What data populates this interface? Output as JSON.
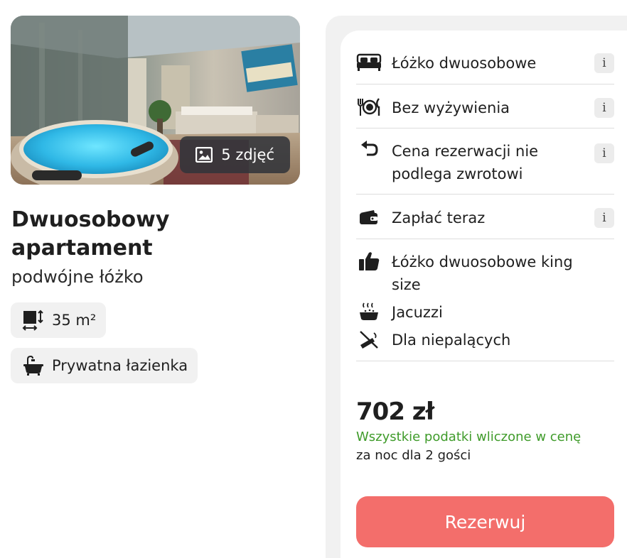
{
  "gallery": {
    "photo_count_label": "5 zdjęć",
    "count_icon": "image-icon"
  },
  "room": {
    "title": "Dwuosobowy apartament",
    "subtitle": "podwójne łóżko",
    "area_label": "35 m²",
    "area_icon": "room-size-icon",
    "bathroom_label": "Prywatna łazienka",
    "bathroom_icon": "bathtub-icon"
  },
  "features": [
    {
      "label": "Łóżko dwuosobowe",
      "icon": "bed-icon",
      "info": "i"
    },
    {
      "label": "Bez wyżywienia",
      "icon": "meal-icon",
      "info": "i"
    },
    {
      "label": "Cena rezerwacji nie podlega zwrotowi",
      "icon": "refund-arrow-icon",
      "info": "i"
    },
    {
      "label": "Zapłać teraz",
      "icon": "wallet-icon",
      "info": "i"
    },
    {
      "label": "Łóżko dwuosobowe king size",
      "icon": "thumbs-up-icon"
    },
    {
      "label": "Jacuzzi",
      "icon": "jacuzzi-icon"
    },
    {
      "label": "Dla niepalących",
      "icon": "no-smoking-icon"
    }
  ],
  "pricing": {
    "price": "702 zł",
    "tax_note": "Wszystkie podatki wliczone w cenę",
    "per_night": "za noc dla 2 gości"
  },
  "actions": {
    "book_label": "Rezerwuj"
  },
  "colors": {
    "accent_button": "#f36e6b",
    "tax_green": "#3f9b2a",
    "pill_bg": "#f1f1f1"
  }
}
